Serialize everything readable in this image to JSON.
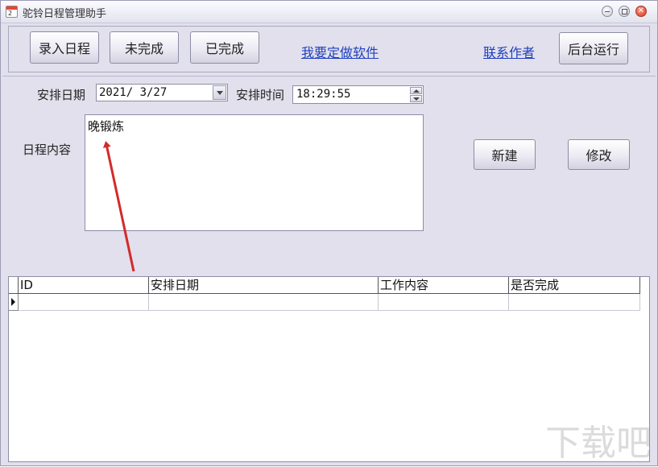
{
  "window": {
    "title": "驼铃日程管理助手",
    "icon_glyph": "2"
  },
  "toolbar": {
    "btn_enter": "录入日程",
    "btn_incomplete": "未完成",
    "btn_complete": "已完成",
    "link_custom": "我要定做软件",
    "link_contact": "联系作者",
    "btn_background": "后台运行"
  },
  "form": {
    "date_label": "安排日期",
    "date_value": "2021/ 3/27",
    "time_label": "安排时间",
    "time_value": "18:29:55",
    "content_label": "日程内容",
    "content_value": "晚锻炼",
    "btn_new": "新建",
    "btn_edit": "修改"
  },
  "grid": {
    "columns": [
      "ID",
      "安排日期",
      "工作内容",
      "是否完成"
    ],
    "rows": [
      [
        "",
        "",
        "",
        ""
      ]
    ]
  },
  "annotation": {
    "arrow_color": "#d42a2a"
  },
  "watermark": {
    "glyphs": "下载吧"
  }
}
